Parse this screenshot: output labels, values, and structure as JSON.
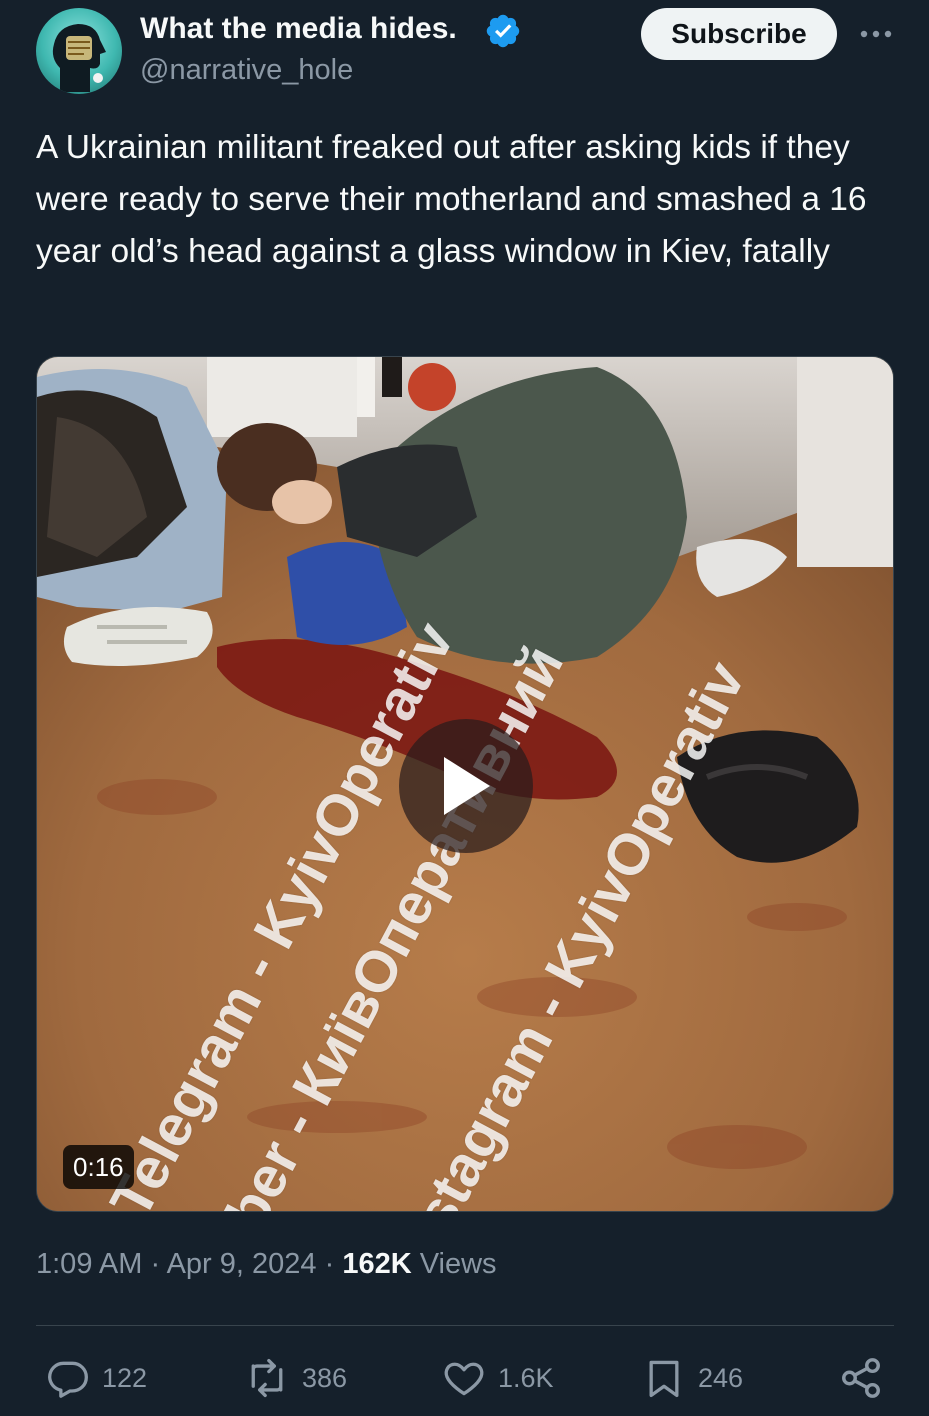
{
  "author": {
    "display_name": "What the media hides.",
    "handle": "@narrative_hole",
    "verified_icon": "verified-badge-icon",
    "avatar_icon": "avatar-head-icon"
  },
  "header": {
    "subscribe_label": "Subscribe",
    "more_icon": "more-dots-icon"
  },
  "tweet": {
    "text": "A Ukrainian militant freaked out after asking kids if they were ready to serve their motherland and smashed a 16 year old’s head against a glass window in Kiev, fatally"
  },
  "media": {
    "duration": "0:16",
    "play_icon": "play-icon",
    "watermarks": [
      "Telegram - KyivOperativ",
      "Viber - КиївОперативний",
      "Instagram - KyivOperativ"
    ]
  },
  "meta": {
    "time": "1:09 AM",
    "separator": " · ",
    "date": "Apr 9, 2024",
    "views_count": "162K",
    "views_label": "Views"
  },
  "actions": {
    "replies": "122",
    "reposts": "386",
    "likes": "1.6K",
    "bookmarks": "246"
  },
  "colors": {
    "background": "#15202b",
    "text_primary": "#f7f9f9",
    "text_secondary": "#8b98a5",
    "verified_blue": "#1d9bf0",
    "divider": "#38444d"
  }
}
